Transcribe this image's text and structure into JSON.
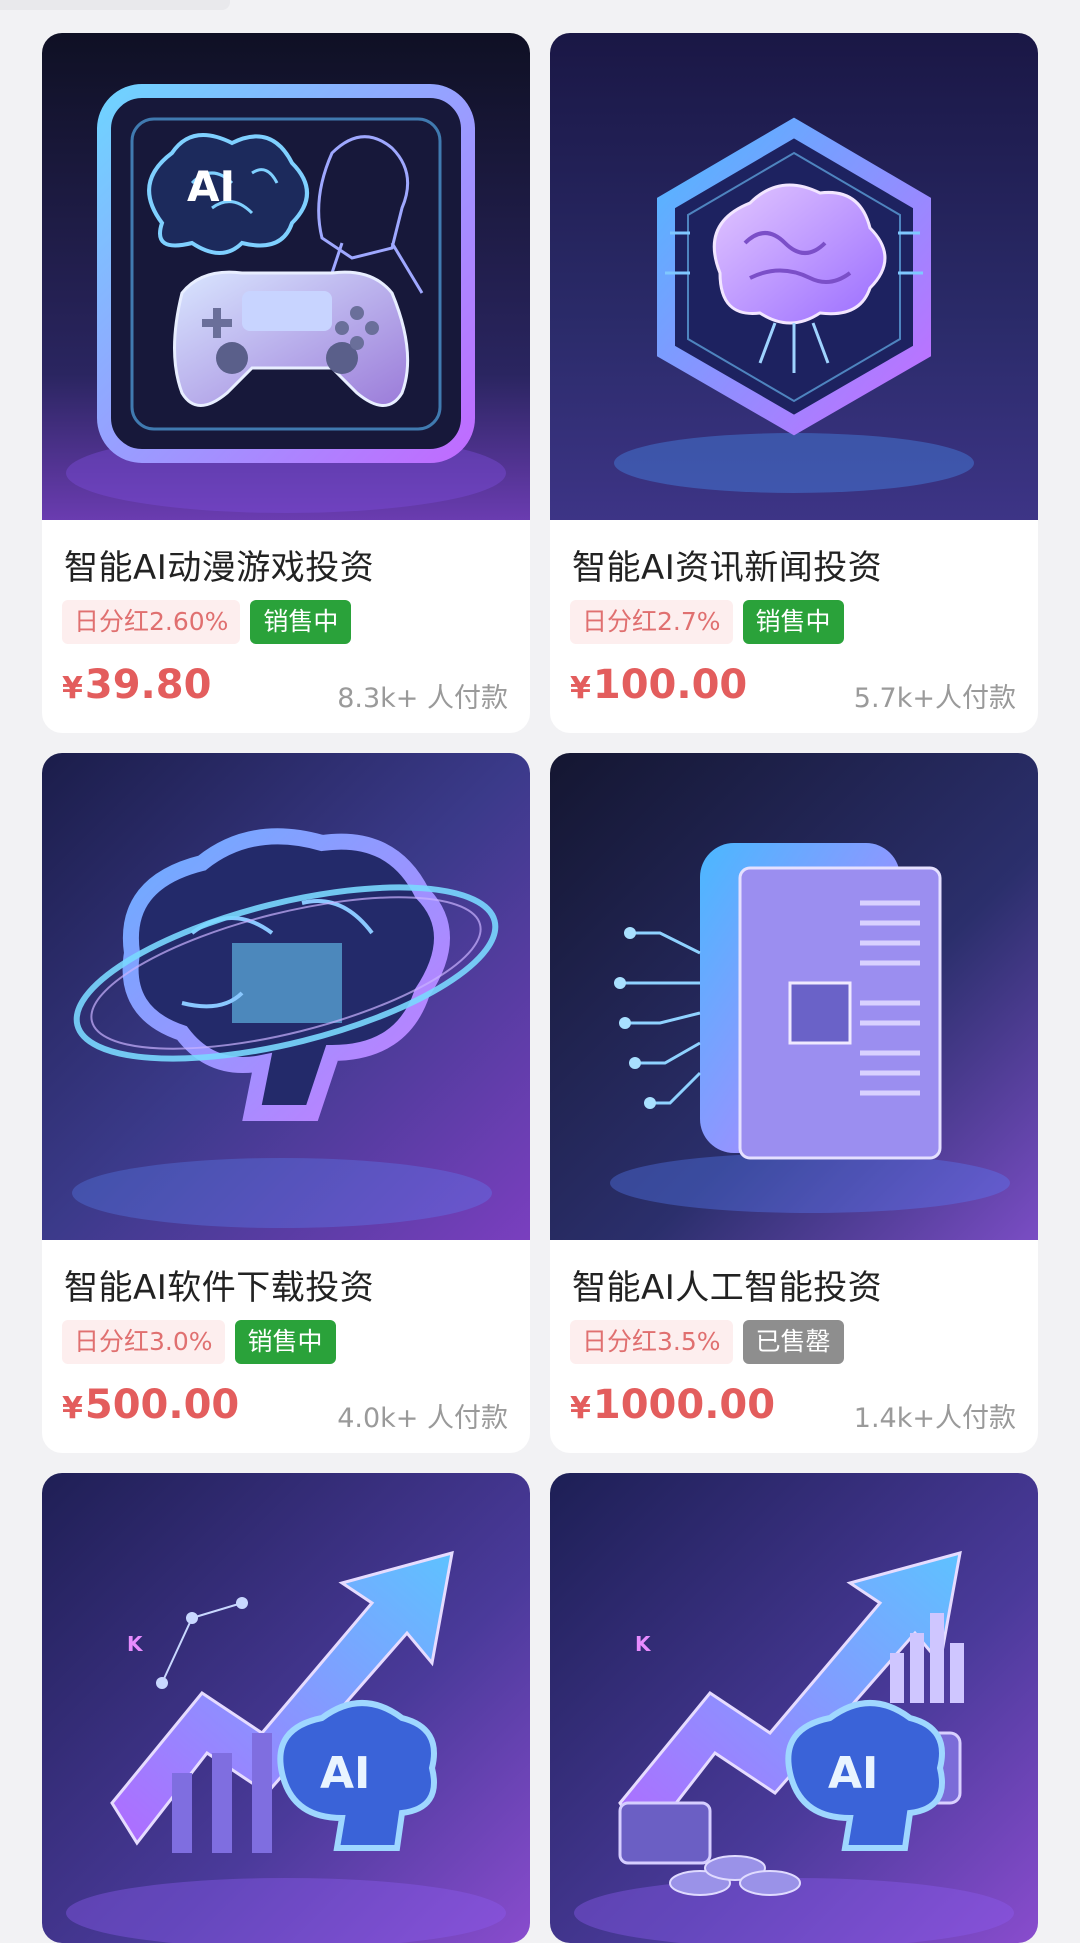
{
  "products": [
    {
      "title": "智能AI动漫游戏投资",
      "dividend": "日分红2.60%",
      "status": "销售中",
      "status_type": "on",
      "currency": "¥",
      "price": "39.80",
      "buyers": "8.3k+ 人付款",
      "image_icon": "ai-game-controller-icon"
    },
    {
      "title": "智能AI资讯新闻投资",
      "dividend": "日分红2.7%",
      "status": "销售中",
      "status_type": "on",
      "currency": "¥",
      "price": "100.00",
      "buyers": "5.7k+人付款",
      "image_icon": "hexagon-brain-icon"
    },
    {
      "title": "智能AI软件下载投资",
      "dividend": "日分红3.0%",
      "status": "销售中",
      "status_type": "on",
      "currency": "¥",
      "price": "500.00",
      "buyers": "4.0k+ 人付款",
      "image_icon": "orbit-brain-icon"
    },
    {
      "title": "智能AI人工智能投资",
      "dividend": "日分红3.5%",
      "status": "已售罄",
      "status_type": "off",
      "currency": "¥",
      "price": "1000.00",
      "buyers": "1.4k+人付款",
      "image_icon": "news-document-icon"
    },
    {
      "image_icon": "ai-growth-chart-icon",
      "image_text": "AI"
    },
    {
      "image_icon": "ai-growth-money-icon",
      "image_text": "AI"
    }
  ],
  "icon_texts": {
    "card1": "AI",
    "chart_k": "K"
  },
  "colors": {
    "price_red": "#e35d5d",
    "on_sale_green": "#2aa23a",
    "sold_out_gray": "#8e8e8e",
    "dividend_bg": "#fdeeee",
    "dividend_text": "#e07070",
    "image_bg_dark": "#1a1a3a",
    "image_accent_blue": "#5ab8ff",
    "image_accent_purple": "#b25cff"
  }
}
